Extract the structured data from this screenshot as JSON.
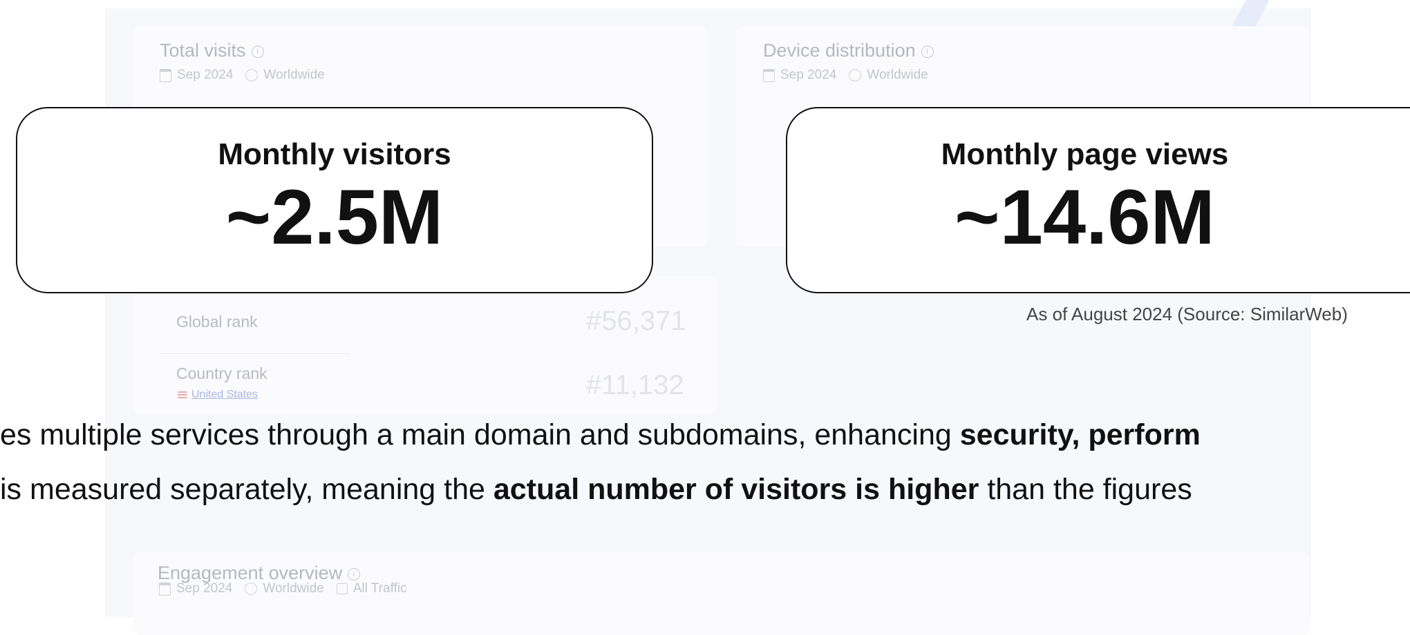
{
  "dashboard": {
    "total_visits": {
      "title": "Total visits",
      "date": "Sep 2024",
      "region": "Worldwide"
    },
    "device_distribution": {
      "title": "Device distribution",
      "date": "Sep 2024",
      "region": "Worldwide"
    },
    "ranks": {
      "global_label": "Global rank",
      "global_value": "#56,371",
      "country_label": "Country rank",
      "country_value": "#11,132",
      "country_link": "United States"
    },
    "engagement": {
      "title": "Engagement overview",
      "date": "Sep 2024",
      "region": "Worldwide",
      "traffic": "All Traffic"
    }
  },
  "highlights": {
    "visitors": {
      "label": "Monthly visitors",
      "value": "~2.5M"
    },
    "page_views": {
      "label": "Monthly page views",
      "value": "~14.6M"
    },
    "source_note": "As of August 2024 (Source: SimilarWeb)"
  },
  "body_text": {
    "line1_pre": "es multiple services through a main domain and subdomains, enhancing ",
    "line1_bold": "security, perform",
    "line2_pre": " is measured separately, meaning the ",
    "line2_bold": "actual number of visitors is higher",
    "line2_post": " than the figures"
  },
  "colors": {
    "accent_border": "#111111",
    "faded_text": "#b4b8c2",
    "link": "#a9b3e4"
  }
}
